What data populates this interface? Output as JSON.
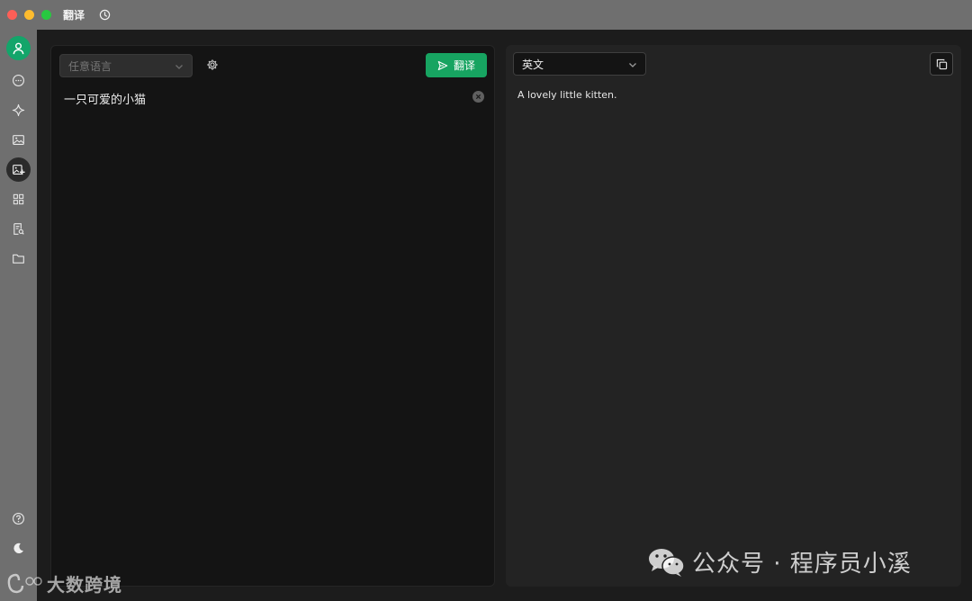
{
  "window": {
    "title": "翻译"
  },
  "source": {
    "language_placeholder": "任意语言",
    "text": "一只可爱的小猫",
    "translate_label": "翻译"
  },
  "target": {
    "language": "英文",
    "text": "A lovely little kitten."
  },
  "sidebar": {
    "items": [
      "chat",
      "sparkle",
      "image",
      "image-edit",
      "apps",
      "document-search",
      "folder"
    ],
    "active": "image-edit",
    "bottom": [
      "help",
      "theme"
    ]
  },
  "watermark": {
    "left": "大数跨境",
    "right": "公众号 · 程序员小溪"
  },
  "colors": {
    "accent": "#17a461",
    "avatar": "#13a56a"
  }
}
